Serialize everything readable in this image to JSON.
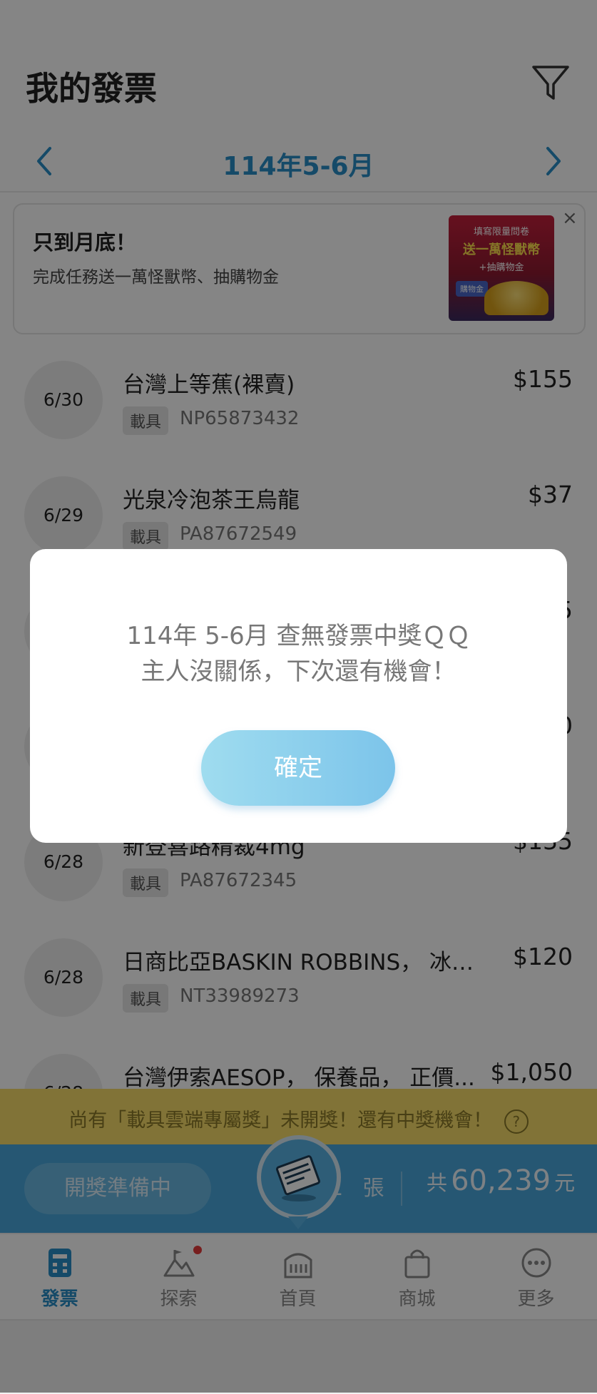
{
  "header": {
    "title": "我的發票",
    "month": "114年5-6月"
  },
  "promo": {
    "title": "只到月底！",
    "subtitle": "完成任務送一萬怪獸幣、抽購物金",
    "image_line1": "填寫限量問卷",
    "image_line2": "送一萬怪獸幣",
    "image_line3": "+抽購物金",
    "image_tag": "購物金",
    "close": "×"
  },
  "invoices": [
    {
      "date": "6/30",
      "name": "台灣上等蕉(裸賣)",
      "price": "$155",
      "badge": "載具",
      "carrier": "NP65873432"
    },
    {
      "date": "6/29",
      "name": "光泉冷泡茶王烏龍",
      "price": "$37",
      "badge": "載具",
      "carrier": "PA87672549"
    },
    {
      "date": "",
      "name": "",
      "price": "5",
      "badge": "",
      "carrier": ""
    },
    {
      "date": "",
      "name": "",
      "price": "0",
      "badge": "",
      "carrier": ""
    },
    {
      "date": "6/28",
      "name": "新登喜路精裁4mg",
      "price": "$135",
      "badge": "載具",
      "carrier": "PA87672345"
    },
    {
      "date": "6/28",
      "name": "日商比亞BASKIN ROBBINS， 冰淇...",
      "price": "$120",
      "badge": "載具",
      "carrier": "NT33989273"
    },
    {
      "date": "6/28",
      "name": "台灣伊索AESOP， 保養品， 正價...",
      "price": "$1,050",
      "badge": "",
      "carrier": ""
    }
  ],
  "notice": {
    "text": "尚有「載具雲端專屬獎」未開獎！還有中獎機會！",
    "help_icon": "?"
  },
  "summary": {
    "draw_status": "開獎準備中",
    "count_partial": "1",
    "count_unit": "張",
    "total_prefix": "共",
    "total_amount": "60,239",
    "total_unit": "元"
  },
  "tabs": [
    {
      "label": "發票",
      "icon": "invoice-icon",
      "active": true
    },
    {
      "label": "探索",
      "icon": "explore-icon",
      "active": false
    },
    {
      "label": "首頁",
      "icon": "home-icon",
      "active": false
    },
    {
      "label": "商城",
      "icon": "shop-icon",
      "active": false
    },
    {
      "label": "更多",
      "icon": "more-icon",
      "active": false
    }
  ],
  "dialog": {
    "line1": "114年 5-6月 查無發票中獎ＱＱ",
    "line2": "主人沒關係，下次還有機會！",
    "confirm": "確定"
  },
  "colors": {
    "accent": "#2a8fc8",
    "summary_bar": "#4aa7dd",
    "notice_bar": "#f7dc6a",
    "badge_dot": "#e53b3b"
  }
}
